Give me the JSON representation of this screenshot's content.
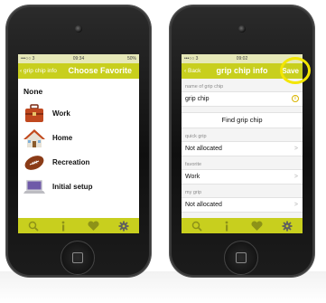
{
  "left_screen": {
    "status": {
      "carrier": "•••○○ 3",
      "time": "09:34",
      "battery": "50%"
    },
    "nav": {
      "back_label": "grip chip info",
      "title": "Choose Favorite"
    },
    "none_label": "None",
    "items": [
      {
        "label": "Work",
        "icon": "toolbox-icon"
      },
      {
        "label": "Home",
        "icon": "house-icon"
      },
      {
        "label": "Recreation",
        "icon": "football-icon"
      },
      {
        "label": "Initial setup",
        "icon": "laptop-icon"
      }
    ],
    "tabbar": [
      "search-icon",
      "info-icon",
      "heart-icon",
      "gear-icon"
    ]
  },
  "right_screen": {
    "status": {
      "carrier": "•••○○ 3",
      "time": "09:02"
    },
    "nav": {
      "back_label": "Back",
      "title": "grip chip info",
      "save_label": "Save"
    },
    "sections": [
      {
        "label": "name of grip chip",
        "value": "grip chip",
        "accessory": "info"
      },
      {
        "label": "",
        "button": "Find grip chip"
      },
      {
        "label": "quick grip",
        "value": "Not allocated",
        "accessory": "chevron"
      },
      {
        "label": "favorite",
        "value": "Work",
        "accessory": "chevron"
      },
      {
        "label": "my grip",
        "value": "Not allocated",
        "accessory": "chevron"
      }
    ],
    "tabbar": [
      "search-icon",
      "info-icon",
      "heart-icon",
      "gear-icon"
    ]
  },
  "colors": {
    "accent": "#c8cf1e",
    "highlight_ring": "#f3e600"
  }
}
